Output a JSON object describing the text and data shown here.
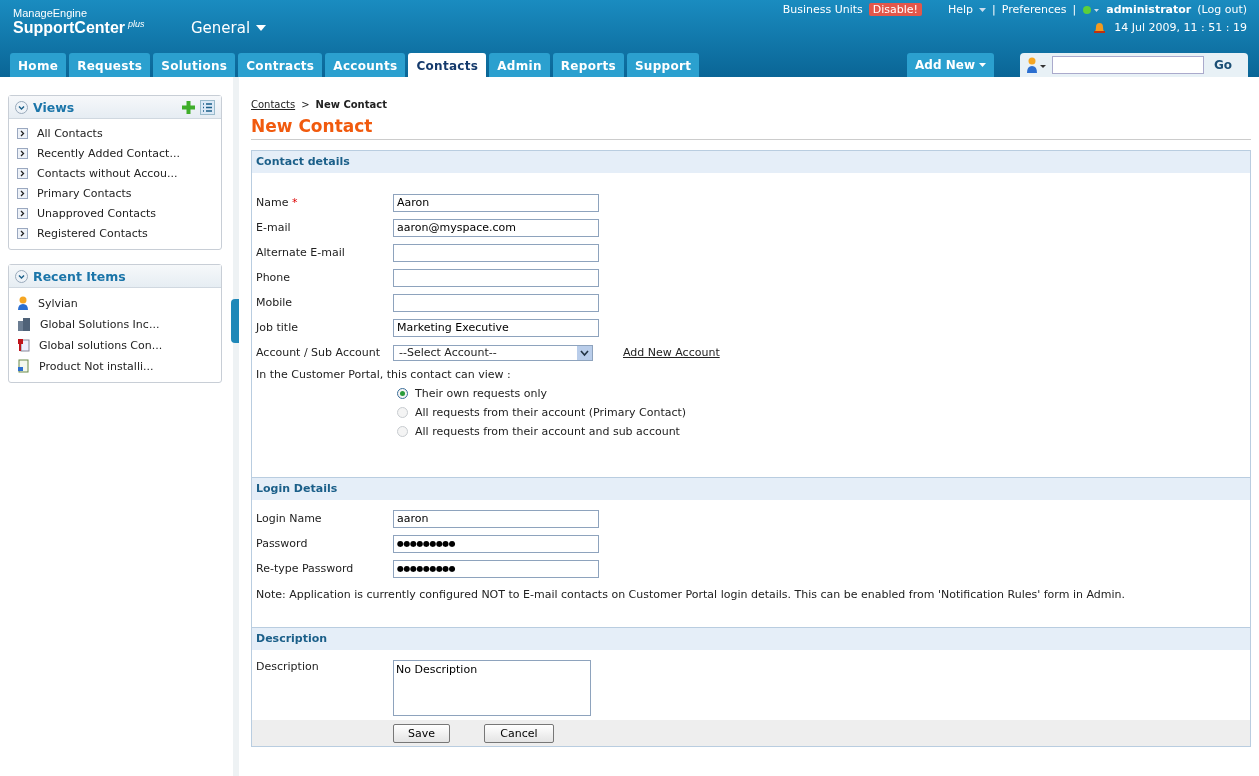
{
  "header": {
    "brand_small": "ManageEngine",
    "brand": "SupportCenter",
    "brand_sup": "plus",
    "module": "General",
    "business_units": "Business Units",
    "disable_badge": "Disable!",
    "help": "Help",
    "preferences": "Preferences",
    "separator": "|",
    "user": "administrator",
    "logout": "(Log out)",
    "datetime": "14 Jul 2009, 11 : 51 : 19",
    "add_new": "Add New",
    "search_button": "Go"
  },
  "tabs": [
    {
      "label": "Home",
      "selected": false
    },
    {
      "label": "Requests",
      "selected": false
    },
    {
      "label": "Solutions",
      "selected": false
    },
    {
      "label": "Contracts",
      "selected": false
    },
    {
      "label": "Accounts",
      "selected": false
    },
    {
      "label": "Contacts",
      "selected": true
    },
    {
      "label": "Admin",
      "selected": false
    },
    {
      "label": "Reports",
      "selected": false
    },
    {
      "label": "Support",
      "selected": false
    }
  ],
  "sidebar": {
    "views": {
      "title": "Views",
      "items": [
        "All Contacts",
        "Recently Added Contact...",
        "Contacts without Accou...",
        "Primary Contacts",
        "Unapproved Contacts",
        "Registered Contacts"
      ]
    },
    "recent": {
      "title": "Recent Items",
      "items": [
        {
          "label": "Sylvian",
          "kind": "person"
        },
        {
          "label": "Global Solutions Inc...",
          "kind": "building"
        },
        {
          "label": "Global solutions Con...",
          "kind": "contract"
        },
        {
          "label": "Product Not installi...",
          "kind": "solution"
        }
      ]
    }
  },
  "breadcrumb": {
    "link": "Contacts",
    "separator": ">",
    "current": "New Contact"
  },
  "title": "New Contact",
  "contact_details": {
    "title": "Contact details",
    "fields": [
      {
        "label": "Name",
        "required": true,
        "kind": "text",
        "value": "Aaron"
      },
      {
        "label": "E-mail",
        "required": false,
        "kind": "text",
        "value": "aaron@myspace.com"
      },
      {
        "label": "Alternate E-mail",
        "required": false,
        "kind": "text"
      },
      {
        "label": "Phone",
        "required": false,
        "kind": "text"
      },
      {
        "label": "Mobile",
        "required": false,
        "kind": "text"
      },
      {
        "label": "Job title",
        "required": false,
        "kind": "text",
        "value": "Marketing Executive"
      },
      {
        "label": "Account / Sub Account",
        "required": false,
        "kind": "select",
        "value": "--Select Account--",
        "link": "Add New Account"
      }
    ],
    "required_mark": "*",
    "portal_prompt": "In the Customer Portal, this contact can view :",
    "options": [
      {
        "label": "Their own requests only",
        "selected": true
      },
      {
        "label": "All requests from their account (Primary Contact)",
        "selected": false
      },
      {
        "label": "All requests from their account and sub account",
        "selected": false
      }
    ]
  },
  "login_details": {
    "title": "Login Details",
    "fields": [
      {
        "label": "Login Name",
        "kind": "text",
        "value": "aaron"
      },
      {
        "label": "Password",
        "kind": "password",
        "value": "●●●●●●●●●"
      },
      {
        "label": "Re-type Password",
        "kind": "password",
        "value": "●●●●●●●●●"
      }
    ],
    "note": "Note: Application is currently configured NOT to E-mail contacts on Customer Portal login details. This can be enabled from 'Notification Rules' form in Admin."
  },
  "description": {
    "title": "Description",
    "label": "Description",
    "value": "No Description"
  },
  "buttons": [
    "Save",
    "Cancel"
  ]
}
